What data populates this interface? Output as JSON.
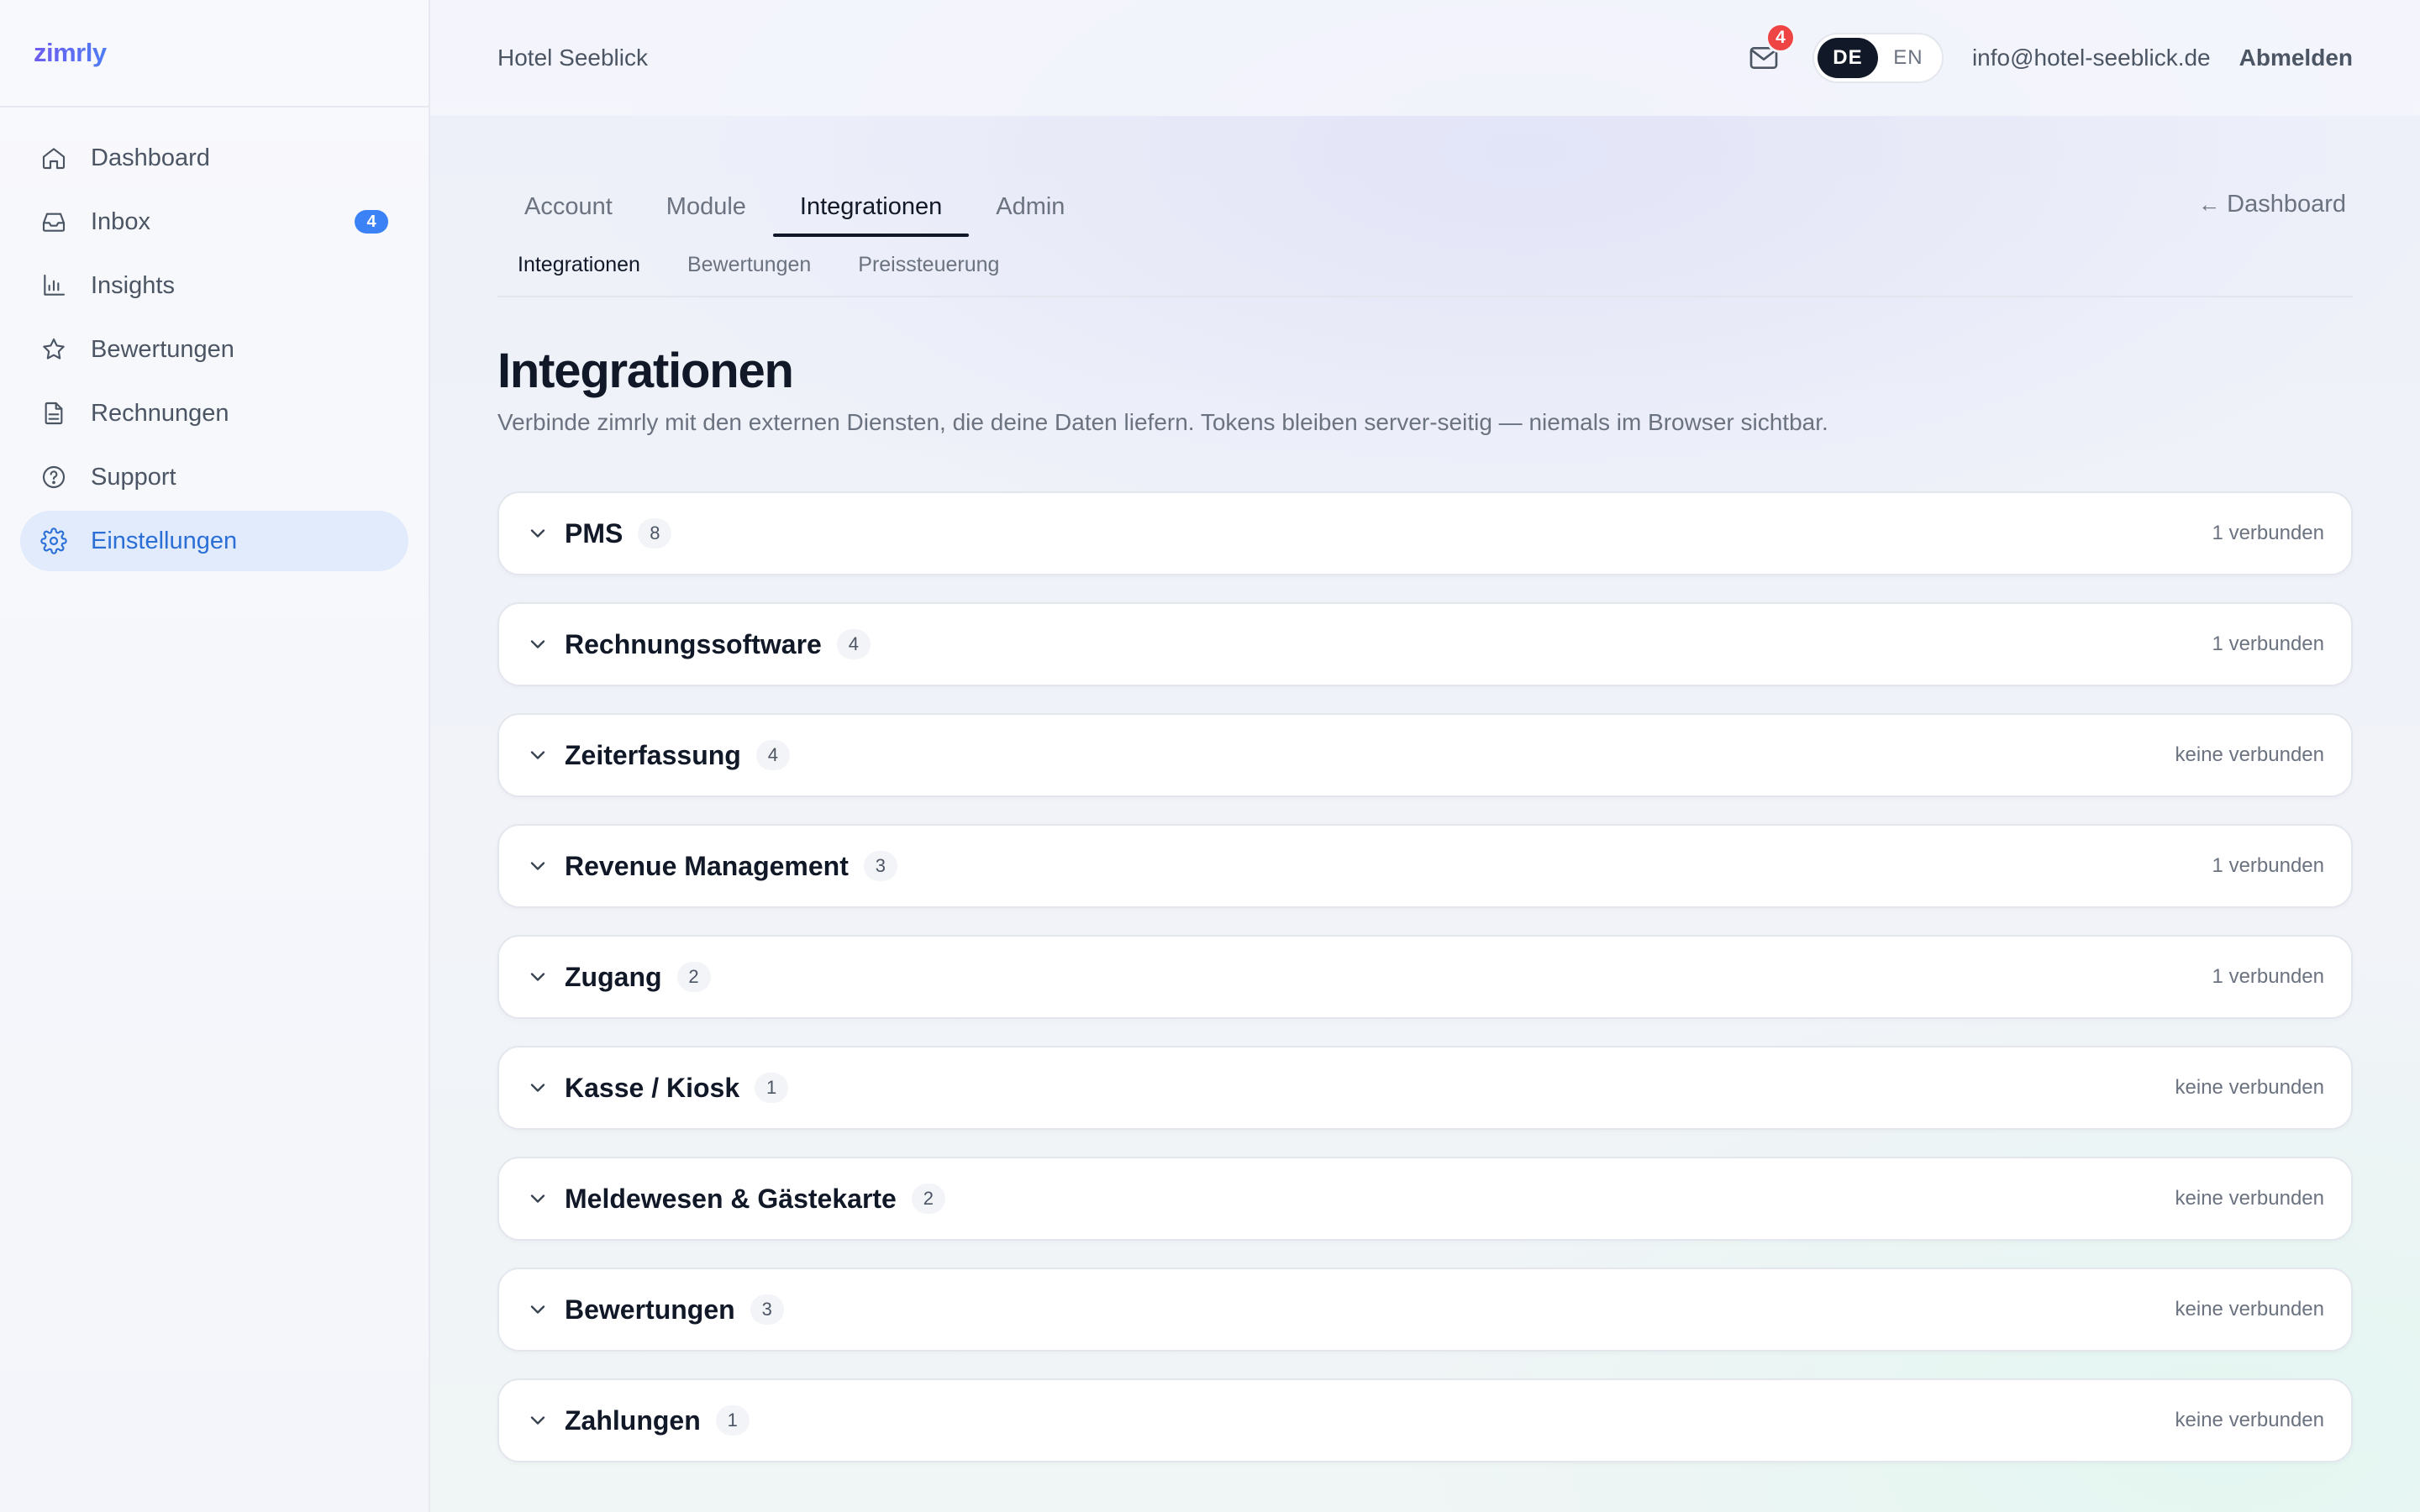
{
  "brand": {
    "name": "zimrly"
  },
  "sidebar": {
    "items": [
      {
        "label": "Dashboard",
        "icon": "home-icon"
      },
      {
        "label": "Inbox",
        "icon": "inbox-icon",
        "badge": "4"
      },
      {
        "label": "Insights",
        "icon": "bar-chart-icon"
      },
      {
        "label": "Bewertungen",
        "icon": "star-icon"
      },
      {
        "label": "Rechnungen",
        "icon": "document-icon"
      },
      {
        "label": "Support",
        "icon": "help-circle-icon"
      },
      {
        "label": "Einstellungen",
        "icon": "gear-icon",
        "active": true
      }
    ]
  },
  "topbar": {
    "hotel": "Hotel Seeblick",
    "mail_badge": "4",
    "languages": [
      "DE",
      "EN"
    ],
    "active_language": "DE",
    "email": "info@hotel-seeblick.de",
    "logout": "Abmelden"
  },
  "tabs": {
    "items": [
      "Account",
      "Module",
      "Integrationen",
      "Admin"
    ],
    "active": "Integrationen",
    "back_link": "Dashboard"
  },
  "subtabs": {
    "items": [
      "Integrationen",
      "Bewertungen",
      "Preissteuerung"
    ],
    "active": "Integrationen"
  },
  "page": {
    "title": "Integrationen",
    "subtitle": "Verbinde zimrly mit den externen Diensten, die deine Daten liefern. Tokens bleiben server-seitig — niemals im Browser sichtbar."
  },
  "groups": [
    {
      "name": "PMS",
      "count": "8",
      "status": "1 verbunden"
    },
    {
      "name": "Rechnungssoftware",
      "count": "4",
      "status": "1 verbunden"
    },
    {
      "name": "Zeiterfassung",
      "count": "4",
      "status": "keine verbunden"
    },
    {
      "name": "Revenue Management",
      "count": "3",
      "status": "1 verbunden"
    },
    {
      "name": "Zugang",
      "count": "2",
      "status": "1 verbunden"
    },
    {
      "name": "Kasse / Kiosk",
      "count": "1",
      "status": "keine verbunden"
    },
    {
      "name": "Meldewesen & Gästekarte",
      "count": "2",
      "status": "keine verbunden"
    },
    {
      "name": "Bewertungen",
      "count": "3",
      "status": "keine verbunden"
    },
    {
      "name": "Zahlungen",
      "count": "1",
      "status": "keine verbunden"
    }
  ],
  "colors": {
    "accent": "#2b6fd6",
    "active_nav_bg": "#e1ebfb",
    "badge_blue": "#3b82f6",
    "badge_red": "#ef4444",
    "dark": "#111827"
  }
}
